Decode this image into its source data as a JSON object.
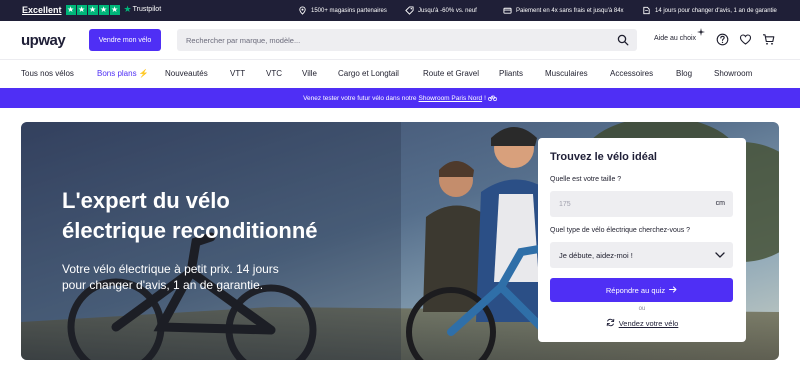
{
  "topbar": {
    "rating": "Excellent",
    "trustpilot": "Trustpilot",
    "usps": [
      {
        "icon": "location-pin-icon",
        "text": "1500+ magasins partenaires"
      },
      {
        "icon": "price-tag-icon",
        "text": "Jusqu'à -60% vs. neuf"
      },
      {
        "icon": "card-icon",
        "text": "Paiement en 4x sans frais et jusqu'à 84x"
      },
      {
        "icon": "return-icon",
        "text": "14 jours pour changer d'avis, 1 an de garantie"
      }
    ],
    "colors": {
      "bg": "#1f1f37",
      "trustpilot_green": "#00b67a"
    }
  },
  "header": {
    "logo": "upway",
    "sell_button": "Vendre mon vélo",
    "search_placeholder": "Rechercher par marque, modèle...",
    "help_label": "Aide au choix",
    "icons": [
      "search-icon",
      "help-icon",
      "heart-icon",
      "cart-icon"
    ],
    "colors": {
      "accent": "#4f2ff5"
    }
  },
  "nav": {
    "items": [
      {
        "label": "Tous nos vélos"
      },
      {
        "label": "Bons plans",
        "active": true
      },
      {
        "label": "Nouveautés"
      },
      {
        "label": "VTT"
      },
      {
        "label": "VTC"
      },
      {
        "label": "Ville"
      },
      {
        "label": "Cargo et Longtail"
      },
      {
        "label": "Route et Gravel"
      },
      {
        "label": "Pliants"
      },
      {
        "label": "Musculaires"
      },
      {
        "label": "Accessoires"
      },
      {
        "label": "Blog"
      },
      {
        "label": "Showroom"
      }
    ]
  },
  "promo": {
    "text_before": "Venez tester votre futur vélo dans notre",
    "link": "Showroom Paris Nord",
    "text_after": "!"
  },
  "hero": {
    "title_line1": "L'expert du vélo",
    "title_line2": "électrique reconditionné",
    "subtitle_line1": "Votre vélo électrique à petit prix. 14 jours",
    "subtitle_line2": "pour changer d'avis, 1 an de garantie."
  },
  "finder": {
    "title": "Trouvez le vélo idéal",
    "size_question": "Quelle est votre taille ?",
    "size_placeholder": "175",
    "size_unit": "cm",
    "type_question": "Quel type de vélo électrique cherchez-vous ?",
    "type_selected": "Je débute, aidez-moi !",
    "quiz_button": "Répondre au quiz",
    "or": "ou",
    "sell_link": "Vendez votre vélo"
  }
}
